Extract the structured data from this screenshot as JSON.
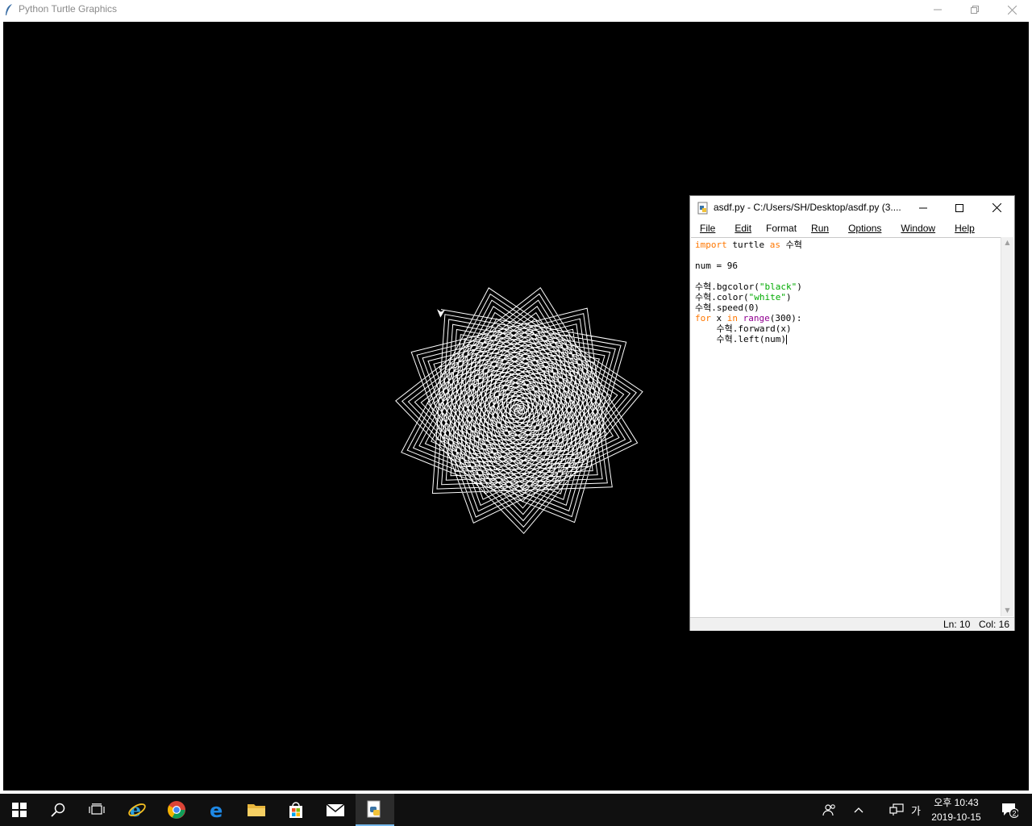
{
  "turtle_window": {
    "title": "Python Turtle Graphics",
    "background": "#000000",
    "pen_color": "#ffffff",
    "pattern": {
      "segments": 300,
      "angle_deg": 96
    }
  },
  "idle_window": {
    "title": "asdf.py - C:/Users/SH/Desktop/asdf.py (3....",
    "menu": [
      "File",
      "Edit",
      "Format",
      "Run",
      "Options",
      "Window",
      "Help"
    ],
    "code_lines": [
      "import turtle as 수혁",
      "",
      "num = 96",
      "",
      "수혁.bgcolor(\"black\")",
      "수혁.color(\"white\")",
      "수혁.speed(0)",
      "for x in range(300):",
      "    수혁.forward(x)",
      "    수혁.left(num)"
    ],
    "status_ln": "Ln: 10",
    "status_col": "Col: 16"
  },
  "taskbar": {
    "icons": [
      "windows-start-icon",
      "search-icon",
      "task-view-icon",
      "internet-explorer-icon",
      "chrome-icon",
      "edge-icon",
      "file-explorer-icon",
      "store-icon",
      "mail-icon",
      "python-idle-icon"
    ],
    "ime_label": "가",
    "clock_time": "오후 10:43",
    "clock_date": "2019-10-15",
    "notification_count": "2"
  }
}
